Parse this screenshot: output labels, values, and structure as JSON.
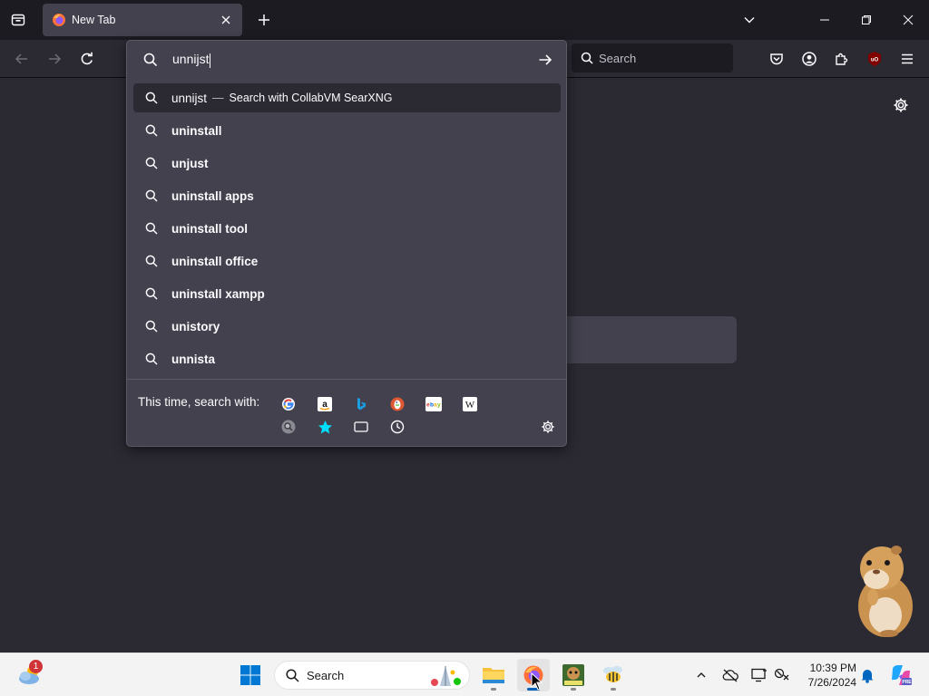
{
  "tab": {
    "title": "New Tab"
  },
  "navbar": {
    "search_placeholder": "Search"
  },
  "urlbar": {
    "input_value": "unnijst",
    "heuristic": {
      "query": "unnijst",
      "separator": "—",
      "action": "Search with CollabVM SearXNG"
    },
    "suggestions": [
      "uninstall",
      "unjust",
      "uninstall apps",
      "uninstall tool",
      "uninstall office",
      "uninstall xampp",
      "unistory",
      "unnista"
    ],
    "oneoff_label": "This time, search with:",
    "engines": [
      "google-icon",
      "amazon-icon",
      "bing-icon",
      "duckduckgo-icon",
      "ebay-icon",
      "wikipedia-icon"
    ],
    "local_modes": [
      "searxng-icon",
      "bookmarks-icon",
      "tabs-icon",
      "history-icon"
    ]
  },
  "taskbar": {
    "search_label": "Search",
    "notification_count": "1",
    "time": "10:39 PM",
    "date": "7/26/2024"
  },
  "colors": {
    "chrome_dark": "#1c1b22",
    "toolbar": "#2b2a33",
    "panel": "#42414d",
    "text": "#fbfbfe",
    "accent_blue": "#005fb8"
  }
}
